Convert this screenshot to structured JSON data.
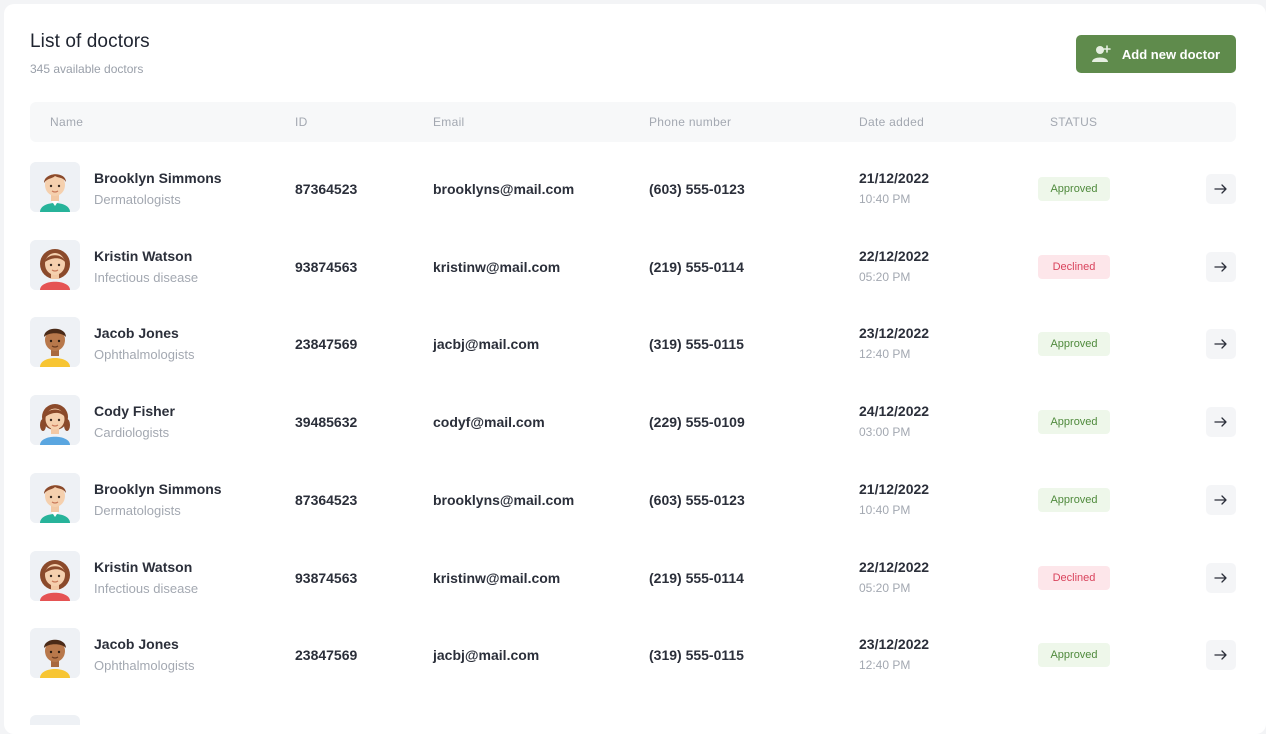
{
  "header": {
    "title": "List of doctors",
    "subtitle": "345 available doctors",
    "add_button_label": "Add new doctor",
    "add_button_icon": "add-user-icon"
  },
  "columns": [
    "Name",
    "ID",
    "Email",
    "Phone number",
    "Date added",
    "STATUS"
  ],
  "colors": {
    "primary": "#5f8b4c",
    "approved_bg": "#eef7ea",
    "approved_text": "#4f8a3c",
    "declined_bg": "#fde6ea",
    "declined_text": "#d9435c"
  },
  "doctors": [
    {
      "name": "Brooklyn Simmons",
      "specialty": "Dermatologists",
      "id": "87364523",
      "email": "brooklyns@mail.com",
      "phone": "(603) 555-0123",
      "date": "21/12/2022",
      "time": "10:40 PM",
      "status": "Approved",
      "avatar": "male-doctor-avatar"
    },
    {
      "name": "Kristin Watson",
      "specialty": "Infectious disease",
      "id": "93874563",
      "email": "kristinw@mail.com",
      "phone": "(219) 555-0114",
      "date": "22/12/2022",
      "time": "05:20 PM",
      "status": "Declined",
      "avatar": "female-doctor-avatar"
    },
    {
      "name": "Jacob Jones",
      "specialty": "Ophthalmologists",
      "id": "23847569",
      "email": "jacbj@mail.com",
      "phone": "(319) 555-0115",
      "date": "23/12/2022",
      "time": "12:40 PM",
      "status": "Approved",
      "avatar": "boy-doctor-avatar"
    },
    {
      "name": "Cody Fisher",
      "specialty": "Cardiologists",
      "id": "39485632",
      "email": "codyf@mail.com",
      "phone": "(229) 555-0109",
      "date": "24/12/2022",
      "time": "03:00 PM",
      "status": "Approved",
      "avatar": "girl-doctor-avatar"
    },
    {
      "name": "Brooklyn Simmons",
      "specialty": "Dermatologists",
      "id": "87364523",
      "email": "brooklyns@mail.com",
      "phone": "(603) 555-0123",
      "date": "21/12/2022",
      "time": "10:40 PM",
      "status": "Approved",
      "avatar": "male-doctor-avatar"
    },
    {
      "name": "Kristin Watson",
      "specialty": "Infectious disease",
      "id": "93874563",
      "email": "kristinw@mail.com",
      "phone": "(219) 555-0114",
      "date": "22/12/2022",
      "time": "05:20 PM",
      "status": "Declined",
      "avatar": "female-doctor-avatar"
    },
    {
      "name": "Jacob Jones",
      "specialty": "Ophthalmologists",
      "id": "23847569",
      "email": "jacbj@mail.com",
      "phone": "(319) 555-0115",
      "date": "23/12/2022",
      "time": "12:40 PM",
      "status": "Approved",
      "avatar": "boy-doctor-avatar"
    }
  ]
}
